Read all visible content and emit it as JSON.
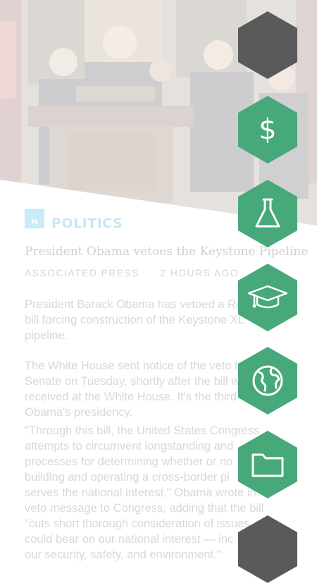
{
  "article": {
    "category_badge": "M",
    "category": "POLITICS",
    "headline": "President Obama vetoes the Keystone Pipeline",
    "source": "ASSOCIATED PRESS",
    "time": "2 HOURS AGO",
    "paragraphs": [
      "President Barack Obama has vetoed a Re\nbill forcing construction of the Keystone XL\npipeline.",
      "The White House sent notice of the veto to\nSenate on Tuesday, shortly after the bill w\nreceived at the White House. It's the third\nObama's presidency.",
      "\"Through this bill, the United States Congress\nattempts to circumvent longstanding and\nprocesses for determining whether or no\nbuilding and operating a cross-border pi\nserves the national interest,\" Obama wrote in\nveto message to Congress, adding that the bill\n\"cuts short thorough consideration of issues\ncould bear on our national interest — inc\nour security, safety, and environment.\""
    ]
  },
  "hex_menu": [
    {
      "icon": "blank",
      "color": "#5a5a5a"
    },
    {
      "icon": "dollar-icon",
      "glyph": "$",
      "color": "#47a87a"
    },
    {
      "icon": "flask-icon",
      "color": "#47a87a"
    },
    {
      "icon": "graduation-cap-icon",
      "color": "#47a87a"
    },
    {
      "icon": "globe-icon",
      "color": "#47a87a"
    },
    {
      "icon": "folder-icon",
      "color": "#47a87a"
    },
    {
      "icon": "blank",
      "color": "#5a5a5a"
    }
  ]
}
